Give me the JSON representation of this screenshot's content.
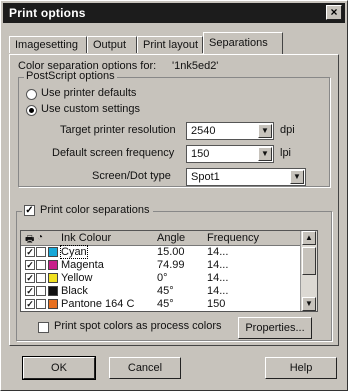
{
  "window": {
    "title": "Print options",
    "close_glyph": "×"
  },
  "tabs": [
    {
      "label": "Imagesetting"
    },
    {
      "label": "Output"
    },
    {
      "label": "Print layout"
    },
    {
      "label": "Separations"
    }
  ],
  "separations": {
    "options_for_label": "Color separation options for:",
    "options_for_value": "'1nk5ed2'",
    "postscript_group_label": "PostScript options",
    "use_printer_defaults": "Use printer defaults",
    "use_custom_settings": "Use custom settings",
    "selected_mode": "custom",
    "target_resolution_label": "Target printer resolution",
    "target_resolution_value": "2540",
    "target_resolution_unit": "dpi",
    "screen_frequency_label": "Default screen frequency",
    "screen_frequency_value": "150",
    "screen_frequency_unit": "lpi",
    "dot_type_label": "Screen/Dot type",
    "dot_type_value": "Spot1",
    "print_separations_label": "Print color separations",
    "print_separations_checked": true
  },
  "ink_table": {
    "headers": {
      "ink": "Ink Colour",
      "angle": "Angle",
      "frequency": "Frequency"
    },
    "rows": [
      {
        "print": true,
        "spot": false,
        "name": "Cyan",
        "color": "#18a8d8",
        "angle": "15.00",
        "frequency": "14...",
        "selected": true
      },
      {
        "print": true,
        "spot": false,
        "name": "Magenta",
        "color": "#c8208a",
        "angle": "74.99",
        "frequency": "14...",
        "selected": false
      },
      {
        "print": true,
        "spot": false,
        "name": "Yellow",
        "color": "#f0e020",
        "angle": "0°",
        "frequency": "14...",
        "selected": false
      },
      {
        "print": true,
        "spot": false,
        "name": "Black",
        "color": "#111111",
        "angle": "45°",
        "frequency": "14...",
        "selected": false
      },
      {
        "print": true,
        "spot": false,
        "name": "Pantone 164 C",
        "color": "#e87020",
        "angle": "45°",
        "frequency": "150",
        "selected": false
      }
    ]
  },
  "spot_as_process_label": "Print spot colors as process colors",
  "spot_as_process_checked": false,
  "properties_button": "Properties...",
  "buttons": {
    "ok": "OK",
    "cancel": "Cancel",
    "help": "Help"
  }
}
